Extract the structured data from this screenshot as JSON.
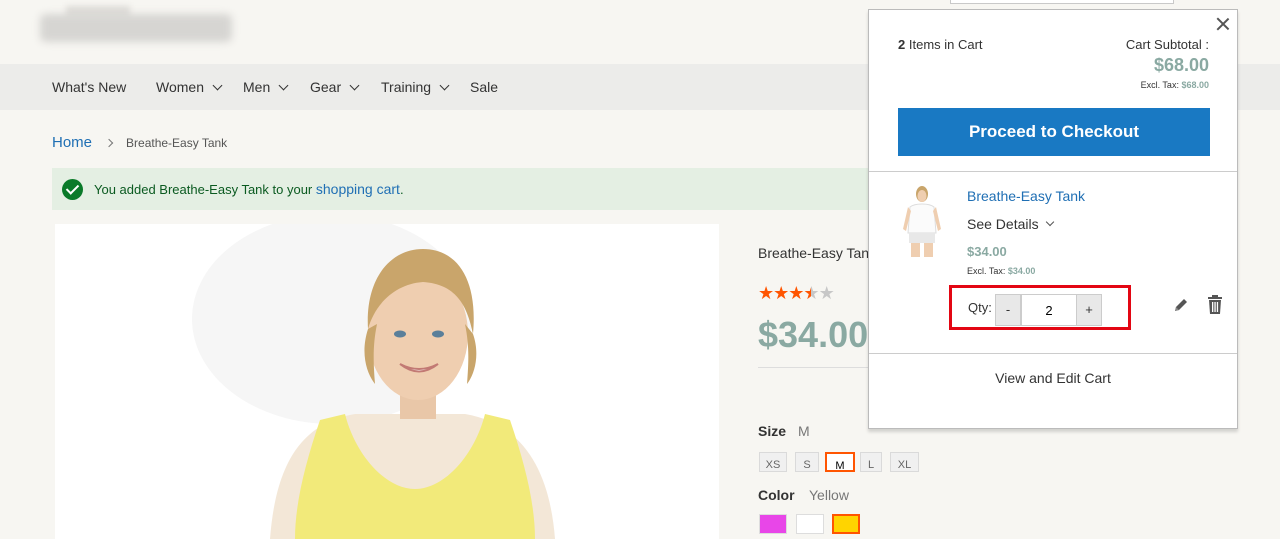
{
  "nav": {
    "items": [
      {
        "label": "What's New",
        "has_dropdown": false
      },
      {
        "label": "Women",
        "has_dropdown": true
      },
      {
        "label": "Men",
        "has_dropdown": true
      },
      {
        "label": "Gear",
        "has_dropdown": true
      },
      {
        "label": "Training",
        "has_dropdown": true
      },
      {
        "label": "Sale",
        "has_dropdown": false
      }
    ]
  },
  "breadcrumb": {
    "home": "Home",
    "current": "Breathe-Easy Tank"
  },
  "message": {
    "prefix": "You added Breathe-Easy Tank to your ",
    "link": "shopping cart",
    "suffix": "."
  },
  "product": {
    "name": "Breathe-Easy Tank",
    "rating_stars": 3.5,
    "rating_max": 5,
    "price": "$34.00",
    "size_label": "Size",
    "size_selected": "M",
    "sizes": [
      "XS",
      "S",
      "M",
      "L",
      "XL"
    ],
    "color_label": "Color",
    "color_selected": "Yellow",
    "colors": [
      "#e846e8",
      "#ffffff",
      "#ffd400"
    ],
    "accent": "#ff5501"
  },
  "minicart": {
    "count": "2",
    "count_label": "Items in Cart",
    "subtotal_label": "Cart Subtotal :",
    "subtotal": "$68.00",
    "excl_label": "Excl. Tax:",
    "excl_value": "$68.00",
    "checkout_label": "Proceed to Checkout",
    "item": {
      "name": "Breathe-Easy Tank",
      "see_details": "See Details",
      "price": "$34.00",
      "excl_label": "Excl. Tax:",
      "excl_value": "$34.00",
      "qty_label": "Qty:",
      "qty_minus": "-",
      "qty_value": "2",
      "qty_plus": "+"
    },
    "view_cart": "View and Edit Cart",
    "brand_color": "#1979c3",
    "highlight_color": "#e30613"
  }
}
